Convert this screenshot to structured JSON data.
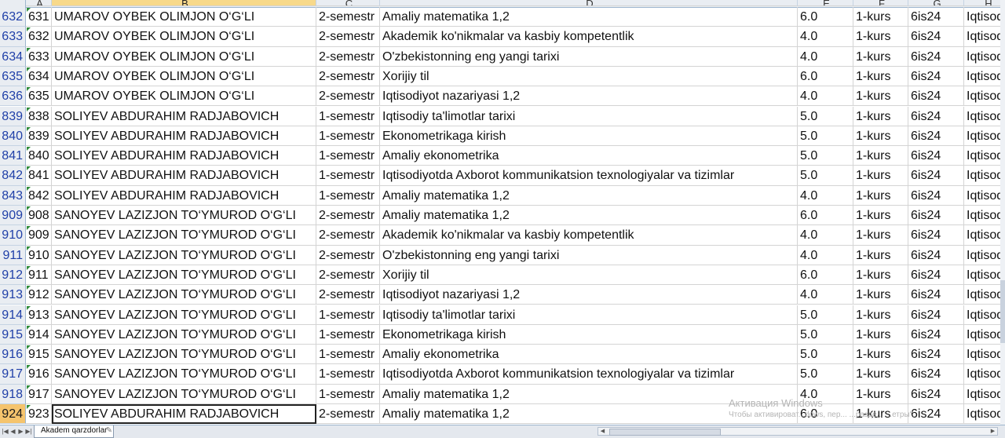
{
  "columns": [
    "A",
    "B",
    "C",
    "D",
    "E",
    "F",
    "G",
    "H"
  ],
  "rows": [
    {
      "rn": "632",
      "a": "631",
      "b": "UMAROV OYBEK OLIMJON O‘G‘LI",
      "c": "2-semestr",
      "d": "Amaliy matematika 1,2",
      "e": "6.0",
      "f": "1-kurs",
      "g": "6is24",
      "h": "Iqtisod"
    },
    {
      "rn": "633",
      "a": "632",
      "b": "UMAROV OYBEK OLIMJON O‘G‘LI",
      "c": "2-semestr",
      "d": "Akademik ko'nikmalar va kasbiy kompetentlik",
      "e": "4.0",
      "f": "1-kurs",
      "g": "6is24",
      "h": "Iqtisod"
    },
    {
      "rn": "634",
      "a": "633",
      "b": "UMAROV OYBEK OLIMJON O‘G‘LI",
      "c": "2-semestr",
      "d": "O'zbekistonning eng yangi tarixi",
      "e": "4.0",
      "f": "1-kurs",
      "g": "6is24",
      "h": "Iqtisod"
    },
    {
      "rn": "635",
      "a": "634",
      "b": "UMAROV OYBEK OLIMJON O‘G‘LI",
      "c": "2-semestr",
      "d": "Xorijiy til",
      "e": "6.0",
      "f": "1-kurs",
      "g": "6is24",
      "h": "Iqtisod"
    },
    {
      "rn": "636",
      "a": "635",
      "b": "UMAROV OYBEK OLIMJON O‘G‘LI",
      "c": "2-semestr",
      "d": "Iqtisodiyot nazariyasi 1,2",
      "e": "4.0",
      "f": "1-kurs",
      "g": "6is24",
      "h": "Iqtisod"
    },
    {
      "rn": "839",
      "a": "838",
      "b": "SOLIYEV ABDURAHIM RADJABOVICH",
      "c": "1-semestr",
      "d": "Iqtisodiy ta'limotlar tarixi",
      "e": "5.0",
      "f": "1-kurs",
      "g": "6is24",
      "h": "Iqtisod"
    },
    {
      "rn": "840",
      "a": "839",
      "b": "SOLIYEV ABDURAHIM RADJABOVICH",
      "c": "1-semestr",
      "d": "Ekonometrikaga kirish",
      "e": "5.0",
      "f": "1-kurs",
      "g": "6is24",
      "h": "Iqtisod"
    },
    {
      "rn": "841",
      "a": "840",
      "b": "SOLIYEV ABDURAHIM RADJABOVICH",
      "c": "1-semestr",
      "d": "Amaliy ekonometrika",
      "e": "5.0",
      "f": "1-kurs",
      "g": "6is24",
      "h": "Iqtisod"
    },
    {
      "rn": "842",
      "a": "841",
      "b": "SOLIYEV ABDURAHIM RADJABOVICH",
      "c": "1-semestr",
      "d": "Iqtisodiyotda Axborot kommunikatsion texnologiyalar va tizimlar",
      "e": "5.0",
      "f": "1-kurs",
      "g": "6is24",
      "h": "Iqtisod"
    },
    {
      "rn": "843",
      "a": "842",
      "b": "SOLIYEV ABDURAHIM RADJABOVICH",
      "c": "1-semestr",
      "d": "Amaliy matematika 1,2",
      "e": "4.0",
      "f": "1-kurs",
      "g": "6is24",
      "h": "Iqtisod"
    },
    {
      "rn": "909",
      "a": "908",
      "b": "SANOYEV LAZIZJON TO‘YMUROD O‘G‘LI",
      "c": "2-semestr",
      "d": "Amaliy matematika 1,2",
      "e": "6.0",
      "f": "1-kurs",
      "g": "6is24",
      "h": "Iqtisod"
    },
    {
      "rn": "910",
      "a": "909",
      "b": "SANOYEV LAZIZJON TO‘YMUROD O‘G‘LI",
      "c": "2-semestr",
      "d": "Akademik ko'nikmalar va kasbiy kompetentlik",
      "e": "4.0",
      "f": "1-kurs",
      "g": "6is24",
      "h": "Iqtisod"
    },
    {
      "rn": "911",
      "a": "910",
      "b": "SANOYEV LAZIZJON TO‘YMUROD O‘G‘LI",
      "c": "2-semestr",
      "d": "O'zbekistonning eng yangi tarixi",
      "e": "4.0",
      "f": "1-kurs",
      "g": "6is24",
      "h": "Iqtisod"
    },
    {
      "rn": "912",
      "a": "911",
      "b": "SANOYEV LAZIZJON TO‘YMUROD O‘G‘LI",
      "c": "2-semestr",
      "d": "Xorijiy til",
      "e": "6.0",
      "f": "1-kurs",
      "g": "6is24",
      "h": "Iqtisod"
    },
    {
      "rn": "913",
      "a": "912",
      "b": "SANOYEV LAZIZJON TO‘YMUROD O‘G‘LI",
      "c": "2-semestr",
      "d": "Iqtisodiyot nazariyasi 1,2",
      "e": "4.0",
      "f": "1-kurs",
      "g": "6is24",
      "h": "Iqtisod"
    },
    {
      "rn": "914",
      "a": "913",
      "b": "SANOYEV LAZIZJON TO‘YMUROD O‘G‘LI",
      "c": "1-semestr",
      "d": "Iqtisodiy ta'limotlar tarixi",
      "e": "5.0",
      "f": "1-kurs",
      "g": "6is24",
      "h": "Iqtisod"
    },
    {
      "rn": "915",
      "a": "914",
      "b": "SANOYEV LAZIZJON TO‘YMUROD O‘G‘LI",
      "c": "1-semestr",
      "d": "Ekonometrikaga kirish",
      "e": "5.0",
      "f": "1-kurs",
      "g": "6is24",
      "h": "Iqtisod"
    },
    {
      "rn": "916",
      "a": "915",
      "b": "SANOYEV LAZIZJON TO‘YMUROD O‘G‘LI",
      "c": "1-semestr",
      "d": "Amaliy ekonometrika",
      "e": "5.0",
      "f": "1-kurs",
      "g": "6is24",
      "h": "Iqtisod"
    },
    {
      "rn": "917",
      "a": "916",
      "b": "SANOYEV LAZIZJON TO‘YMUROD O‘G‘LI",
      "c": "1-semestr",
      "d": "Iqtisodiyotda Axborot kommunikatsion texnologiyalar va tizimlar",
      "e": "5.0",
      "f": "1-kurs",
      "g": "6is24",
      "h": "Iqtisod"
    },
    {
      "rn": "918",
      "a": "917",
      "b": "SANOYEV LAZIZJON TO‘YMUROD O‘G‘LI",
      "c": "1-semestr",
      "d": "Amaliy matematika 1,2",
      "e": "4.0",
      "f": "1-kurs",
      "g": "6is24",
      "h": "Iqtisod"
    },
    {
      "rn": "924",
      "a": "923",
      "b": "SOLIYEV ABDURAHIM RADJABOVICH",
      "c": "2-semestr",
      "d": "Amaliy matematika 1,2",
      "e": "6.0",
      "f": "1-kurs",
      "g": "6is24",
      "h": "Iqtisod",
      "selected": true
    }
  ],
  "sheet_tab": "Akadem qarzdorlar",
  "nav_icons": [
    "first-sheet-icon",
    "prev-sheet-icon",
    "next-sheet-icon",
    "last-sheet-icon"
  ],
  "watermark": {
    "line1": "Активация Windows",
    "line2": "Чтобы активироват...dows, пер... ...разде... ...етры\"."
  },
  "colors": {
    "row_number": "#1f3fa8",
    "selected_header": "#f5c46d",
    "header_bg": "#e9edf2"
  }
}
